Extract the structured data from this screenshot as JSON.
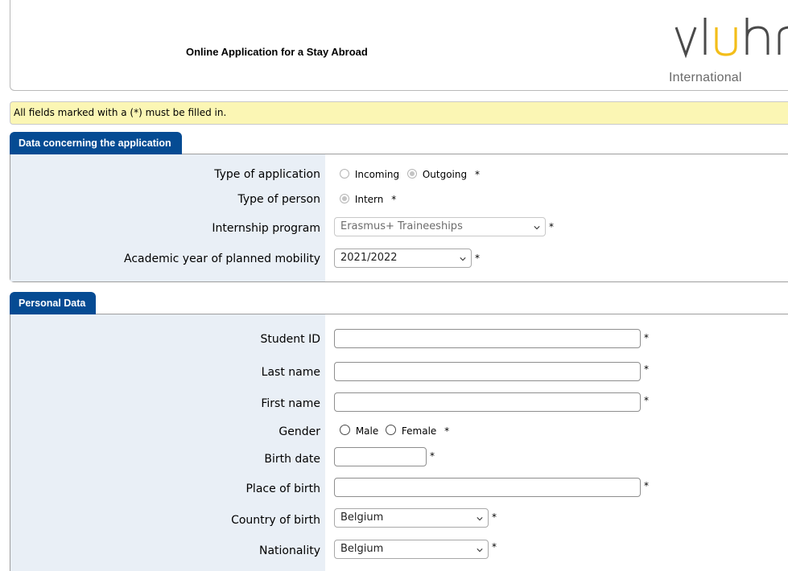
{
  "header": {
    "title": "Online Application for a Stay Abroad",
    "logo_text": "vluhr",
    "logo_sub": "International"
  },
  "notice": "All fields marked with a (*) must be filled in.",
  "required_mark": "*",
  "application": {
    "tab_label": "Data concerning the application",
    "type_of_application": {
      "label": "Type of application",
      "options": [
        "Incoming",
        "Outgoing"
      ],
      "selected": "Outgoing"
    },
    "type_of_person": {
      "label": "Type of person",
      "options": [
        "Intern"
      ],
      "selected": "Intern"
    },
    "internship_program": {
      "label": "Internship program",
      "value": "Erasmus+ Traineeships"
    },
    "academic_year": {
      "label": "Academic year of planned mobility",
      "value": "2021/2022"
    }
  },
  "personal": {
    "tab_label": "Personal Data",
    "student_id": {
      "label": "Student ID",
      "value": ""
    },
    "last_name": {
      "label": "Last name",
      "value": ""
    },
    "first_name": {
      "label": "First name",
      "value": ""
    },
    "gender": {
      "label": "Gender",
      "options": [
        "Male",
        "Female"
      ],
      "selected": ""
    },
    "birth_date": {
      "label": "Birth date",
      "value": ""
    },
    "place_of_birth": {
      "label": "Place of birth",
      "value": ""
    },
    "country_of_birth": {
      "label": "Country of birth",
      "value": "Belgium"
    },
    "nationality": {
      "label": "Nationality",
      "value": "Belgium"
    }
  }
}
